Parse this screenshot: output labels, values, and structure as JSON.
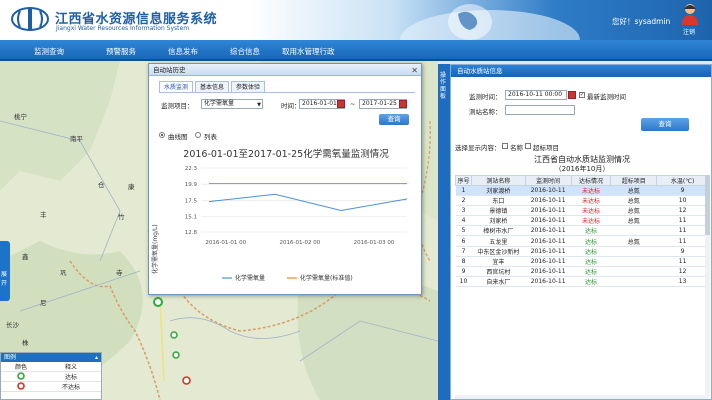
{
  "header": {
    "title": "江西省水资源信息服务系统",
    "subtitle": "Jiangxi Water Resources Information System",
    "welcome": "您好！sysadmin",
    "logout": "注销"
  },
  "nav": [
    "监测查询",
    "预警服务",
    "信息发布",
    "综合信息",
    "取用水管理行政"
  ],
  "map": {
    "labels": [
      "桃宁",
      "南平",
      "仓",
      "丰",
      "康",
      "竹",
      "鑫",
      "巩",
      "寺",
      "尼",
      "长沙",
      "株",
      "湘"
    ],
    "side_tab": "展开"
  },
  "legend": {
    "title": "图例",
    "col_color": "颜色",
    "col_meaning": "释义",
    "rows": [
      {
        "meaning": "达标",
        "color": "#2eaa3a"
      },
      {
        "meaning": "不达标",
        "color": "#d4341e"
      }
    ]
  },
  "popup": {
    "title": "自动站历史",
    "tabs": [
      "水质监测",
      "基本信息",
      "参数体验"
    ],
    "item_label": "监测项目：",
    "item_value": "化学需氧量",
    "time_label": "时间：",
    "date_from": "2016-01-01",
    "tilde": "~",
    "date_to": "2017-01-25",
    "query_btn": "查询",
    "view_chart": "曲线图",
    "view_list": "列表"
  },
  "chart_data": {
    "type": "line",
    "title": "2016-01-01至2017-01-25化学需氧量监测情况",
    "ylabel": "化学需氧量(mg/L)",
    "x": [
      "2016-01-01 00",
      "2016-01-02 00",
      "2016-01-03 00"
    ],
    "ylim": [
      12.8,
      22.3
    ],
    "yticks": [
      "22.3",
      "19.9",
      "17.5",
      "15.1",
      "12.8"
    ],
    "series": [
      {
        "name": "化学需氧量",
        "color": "#4a90d9",
        "values": [
          17.3,
          18.4,
          16.0,
          17.7
        ]
      },
      {
        "name": "化学需氧量(标准值)",
        "color": "#f08a24",
        "values": [
          20.0,
          20.0,
          20.0,
          20.0
        ]
      }
    ]
  },
  "right_panel": {
    "side_tab": "操作面板",
    "title": "自动水质站信息",
    "time_label": "监测时间：",
    "time_value": "2016-10-11 00:00",
    "latest_label": "最新监测时间",
    "station_label": "测站名称：",
    "station_value": "",
    "query_btn": "查询",
    "filter_label": "选择显示内容：",
    "opt_name": "名称",
    "opt_type": "超标项目",
    "table_title": "江西省自动水质站监测情况",
    "table_sub": "（2016年10月）",
    "columns": [
      "序号",
      "测站名称",
      "监测时间",
      "达标情况",
      "超标项目",
      "水温(℃)"
    ],
    "rows": [
      {
        "no": "1",
        "name": "刘家渡桥",
        "time": "2016-10-11",
        "status": "未达标",
        "item": "总氮",
        "temp": "9"
      },
      {
        "no": "2",
        "name": "东口",
        "time": "2016-10-11",
        "status": "未达标",
        "item": "总氮",
        "temp": "10"
      },
      {
        "no": "3",
        "name": "景德镇",
        "time": "2016-10-11",
        "status": "未达标",
        "item": "总氮",
        "temp": "12"
      },
      {
        "no": "4",
        "name": "刘家桥",
        "time": "2016-10-11",
        "status": "未达标",
        "item": "总氮",
        "temp": "11"
      },
      {
        "no": "5",
        "name": "樟树市水厂",
        "time": "2016-10-11",
        "status": "达标",
        "item": "",
        "temp": "11"
      },
      {
        "no": "6",
        "name": "五龙里",
        "time": "2016-10-11",
        "status": "达标",
        "item": "总氮",
        "temp": "11"
      },
      {
        "no": "7",
        "name": "中东区金沙新村",
        "time": "2016-10-11",
        "status": "达标",
        "item": "",
        "temp": "9"
      },
      {
        "no": "8",
        "name": "宜丰",
        "time": "2016-10-11",
        "status": "达标",
        "item": "",
        "temp": "11"
      },
      {
        "no": "9",
        "name": "西官坑村",
        "time": "2016-10-11",
        "status": "达标",
        "item": "",
        "temp": "12"
      },
      {
        "no": "10",
        "name": "自来水厂",
        "time": "2016-10-11",
        "status": "达标",
        "item": "",
        "temp": "13"
      }
    ]
  }
}
